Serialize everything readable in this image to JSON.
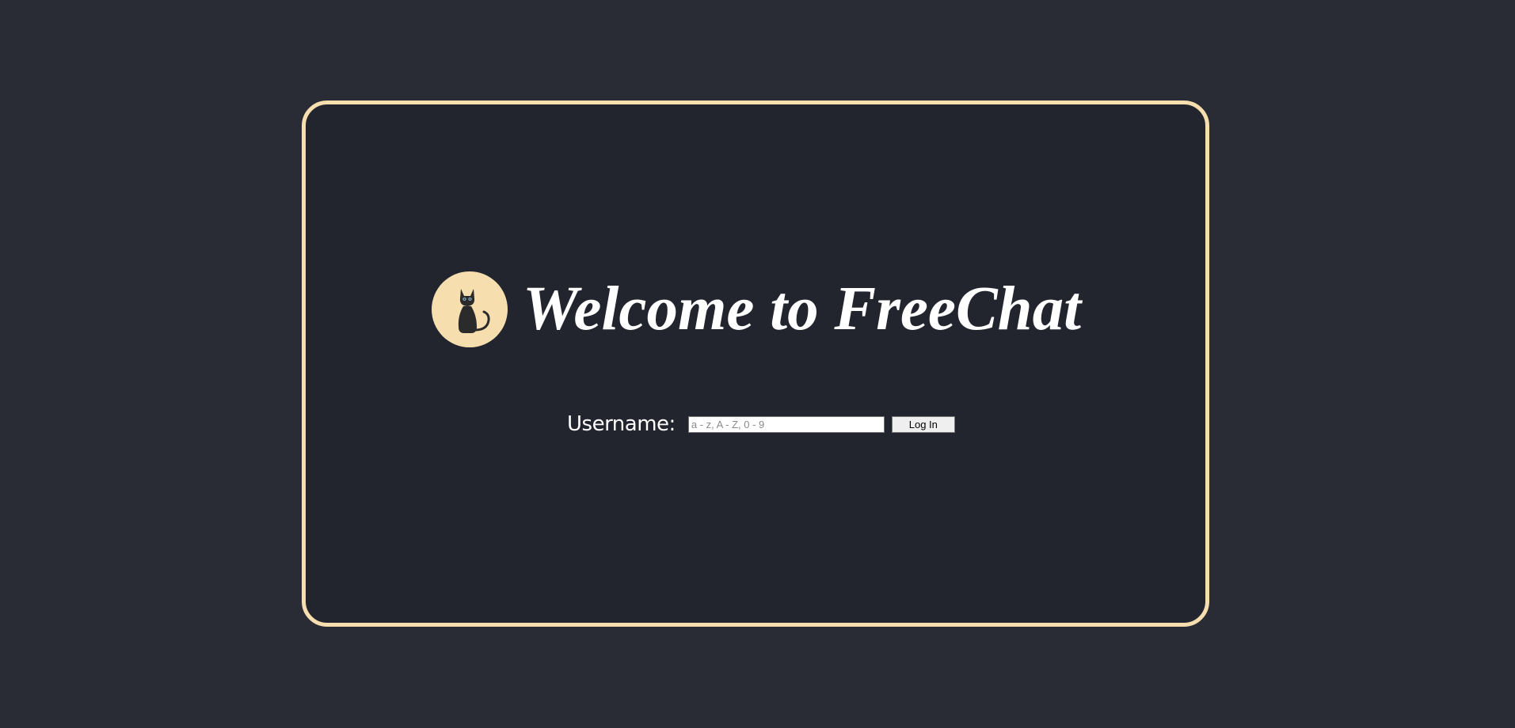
{
  "welcome": {
    "title": "Welcome to FreeChat",
    "logo_icon": "cat-icon"
  },
  "login": {
    "username_label": "Username:",
    "username_placeholder": "a - z, A - Z, 0 - 9",
    "username_value": "",
    "button_label": "Log In"
  },
  "colors": {
    "page_background": "#292c35",
    "card_background": "#22252d",
    "card_border": "#f6deaf",
    "logo_background": "#f6deaf",
    "cat": "#2b2b2b",
    "title_text": "#ffffff"
  }
}
